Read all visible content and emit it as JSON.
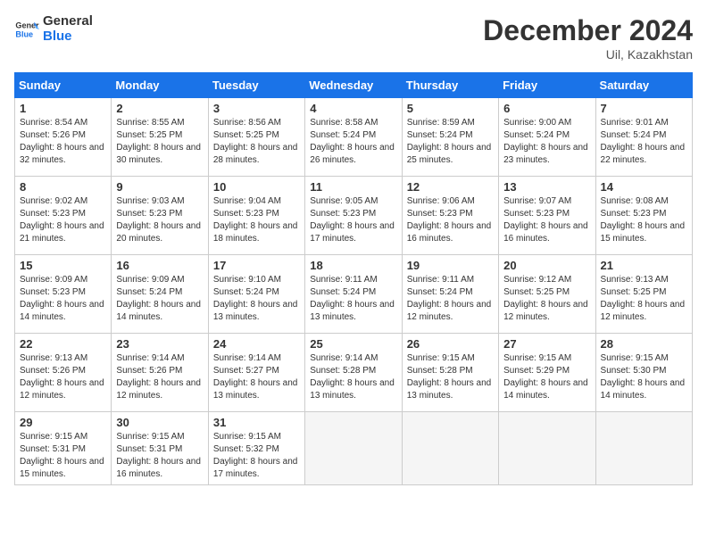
{
  "header": {
    "logo_line1": "General",
    "logo_line2": "Blue",
    "title": "December 2024",
    "location": "Uil, Kazakhstan"
  },
  "calendar": {
    "days_of_week": [
      "Sunday",
      "Monday",
      "Tuesday",
      "Wednesday",
      "Thursday",
      "Friday",
      "Saturday"
    ],
    "weeks": [
      [
        {
          "day": 1,
          "sunrise": "8:54 AM",
          "sunset": "5:26 PM",
          "daylight": "8 hours and 32 minutes."
        },
        {
          "day": 2,
          "sunrise": "8:55 AM",
          "sunset": "5:25 PM",
          "daylight": "8 hours and 30 minutes."
        },
        {
          "day": 3,
          "sunrise": "8:56 AM",
          "sunset": "5:25 PM",
          "daylight": "8 hours and 28 minutes."
        },
        {
          "day": 4,
          "sunrise": "8:58 AM",
          "sunset": "5:24 PM",
          "daylight": "8 hours and 26 minutes."
        },
        {
          "day": 5,
          "sunrise": "8:59 AM",
          "sunset": "5:24 PM",
          "daylight": "8 hours and 25 minutes."
        },
        {
          "day": 6,
          "sunrise": "9:00 AM",
          "sunset": "5:24 PM",
          "daylight": "8 hours and 23 minutes."
        },
        {
          "day": 7,
          "sunrise": "9:01 AM",
          "sunset": "5:24 PM",
          "daylight": "8 hours and 22 minutes."
        }
      ],
      [
        {
          "day": 8,
          "sunrise": "9:02 AM",
          "sunset": "5:23 PM",
          "daylight": "8 hours and 21 minutes."
        },
        {
          "day": 9,
          "sunrise": "9:03 AM",
          "sunset": "5:23 PM",
          "daylight": "8 hours and 20 minutes."
        },
        {
          "day": 10,
          "sunrise": "9:04 AM",
          "sunset": "5:23 PM",
          "daylight": "8 hours and 18 minutes."
        },
        {
          "day": 11,
          "sunrise": "9:05 AM",
          "sunset": "5:23 PM",
          "daylight": "8 hours and 17 minutes."
        },
        {
          "day": 12,
          "sunrise": "9:06 AM",
          "sunset": "5:23 PM",
          "daylight": "8 hours and 16 minutes."
        },
        {
          "day": 13,
          "sunrise": "9:07 AM",
          "sunset": "5:23 PM",
          "daylight": "8 hours and 16 minutes."
        },
        {
          "day": 14,
          "sunrise": "9:08 AM",
          "sunset": "5:23 PM",
          "daylight": "8 hours and 15 minutes."
        }
      ],
      [
        {
          "day": 15,
          "sunrise": "9:09 AM",
          "sunset": "5:23 PM",
          "daylight": "8 hours and 14 minutes."
        },
        {
          "day": 16,
          "sunrise": "9:09 AM",
          "sunset": "5:24 PM",
          "daylight": "8 hours and 14 minutes."
        },
        {
          "day": 17,
          "sunrise": "9:10 AM",
          "sunset": "5:24 PM",
          "daylight": "8 hours and 13 minutes."
        },
        {
          "day": 18,
          "sunrise": "9:11 AM",
          "sunset": "5:24 PM",
          "daylight": "8 hours and 13 minutes."
        },
        {
          "day": 19,
          "sunrise": "9:11 AM",
          "sunset": "5:24 PM",
          "daylight": "8 hours and 12 minutes."
        },
        {
          "day": 20,
          "sunrise": "9:12 AM",
          "sunset": "5:25 PM",
          "daylight": "8 hours and 12 minutes."
        },
        {
          "day": 21,
          "sunrise": "9:13 AM",
          "sunset": "5:25 PM",
          "daylight": "8 hours and 12 minutes."
        }
      ],
      [
        {
          "day": 22,
          "sunrise": "9:13 AM",
          "sunset": "5:26 PM",
          "daylight": "8 hours and 12 minutes."
        },
        {
          "day": 23,
          "sunrise": "9:14 AM",
          "sunset": "5:26 PM",
          "daylight": "8 hours and 12 minutes."
        },
        {
          "day": 24,
          "sunrise": "9:14 AM",
          "sunset": "5:27 PM",
          "daylight": "8 hours and 13 minutes."
        },
        {
          "day": 25,
          "sunrise": "9:14 AM",
          "sunset": "5:28 PM",
          "daylight": "8 hours and 13 minutes."
        },
        {
          "day": 26,
          "sunrise": "9:15 AM",
          "sunset": "5:28 PM",
          "daylight": "8 hours and 13 minutes."
        },
        {
          "day": 27,
          "sunrise": "9:15 AM",
          "sunset": "5:29 PM",
          "daylight": "8 hours and 14 minutes."
        },
        {
          "day": 28,
          "sunrise": "9:15 AM",
          "sunset": "5:30 PM",
          "daylight": "8 hours and 14 minutes."
        }
      ],
      [
        {
          "day": 29,
          "sunrise": "9:15 AM",
          "sunset": "5:31 PM",
          "daylight": "8 hours and 15 minutes."
        },
        {
          "day": 30,
          "sunrise": "9:15 AM",
          "sunset": "5:31 PM",
          "daylight": "8 hours and 16 minutes."
        },
        {
          "day": 31,
          "sunrise": "9:15 AM",
          "sunset": "5:32 PM",
          "daylight": "8 hours and 17 minutes."
        },
        null,
        null,
        null,
        null
      ]
    ]
  }
}
